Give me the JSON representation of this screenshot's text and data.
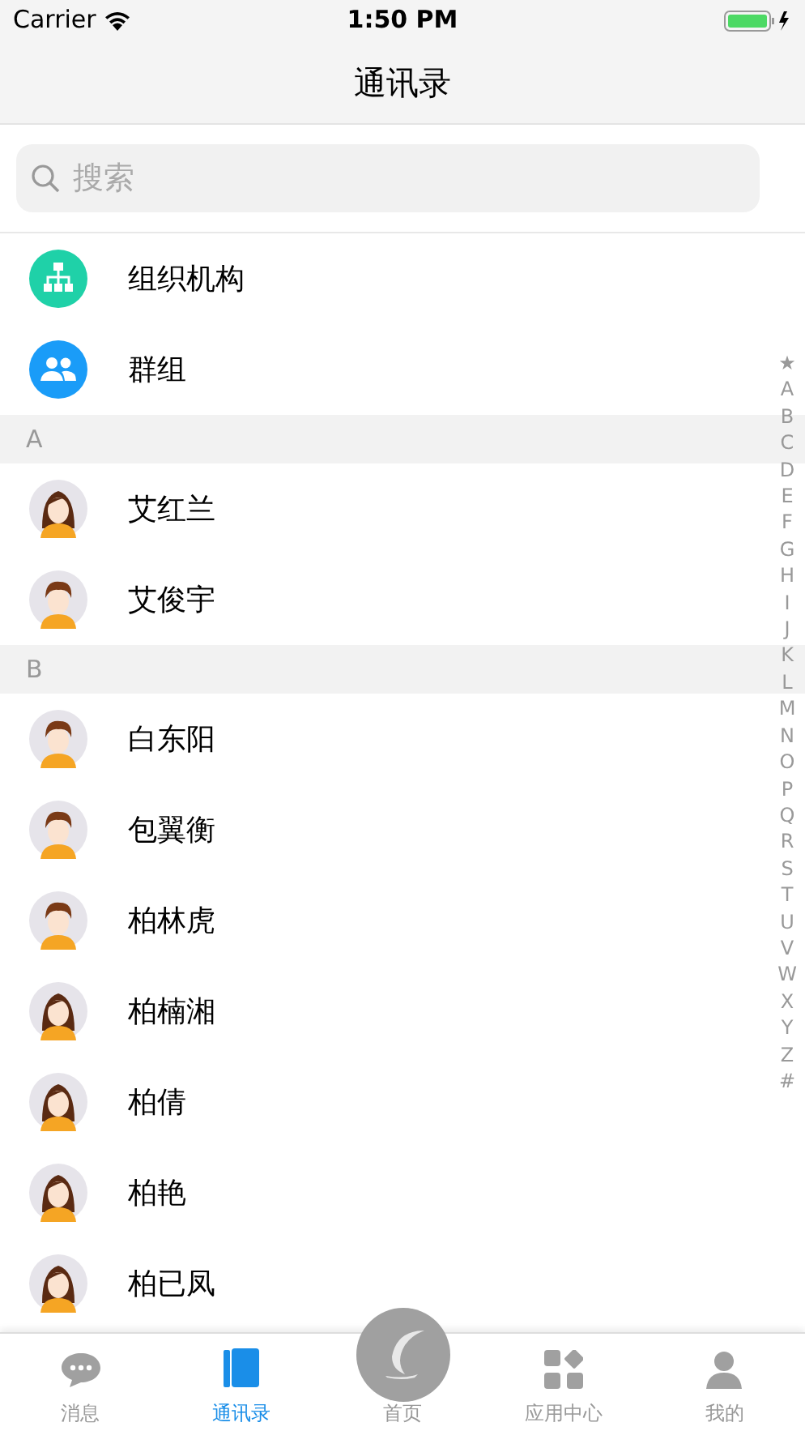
{
  "status_bar": {
    "carrier": "Carrier",
    "time": "1:50 PM"
  },
  "title": "通讯录",
  "search": {
    "placeholder": "搜索"
  },
  "shortcuts": [
    {
      "label": "组织机构",
      "kind": "org"
    },
    {
      "label": "群组",
      "kind": "group"
    }
  ],
  "sections": [
    {
      "letter": "A",
      "contacts": [
        {
          "name": "艾红兰",
          "kind": "female"
        },
        {
          "name": "艾俊宇",
          "kind": "male"
        }
      ]
    },
    {
      "letter": "B",
      "contacts": [
        {
          "name": "白东阳",
          "kind": "male"
        },
        {
          "name": "包翼衡",
          "kind": "male"
        },
        {
          "name": "柏林虎",
          "kind": "male"
        },
        {
          "name": "柏楠湘",
          "kind": "female"
        },
        {
          "name": "柏倩",
          "kind": "female"
        },
        {
          "name": "柏艳",
          "kind": "female"
        },
        {
          "name": "柏已凤",
          "kind": "female"
        }
      ]
    }
  ],
  "index": [
    "★",
    "A",
    "B",
    "C",
    "D",
    "E",
    "F",
    "G",
    "H",
    "I",
    "J",
    "K",
    "L",
    "M",
    "N",
    "O",
    "P",
    "Q",
    "R",
    "S",
    "T",
    "U",
    "V",
    "W",
    "X",
    "Y",
    "Z",
    "#"
  ],
  "tabs": [
    {
      "label": "消息",
      "kind": "chat",
      "selected": false
    },
    {
      "label": "通讯录",
      "kind": "contacts",
      "selected": true
    },
    {
      "label": "首页",
      "kind": "home",
      "selected": false
    },
    {
      "label": "应用中心",
      "kind": "apps",
      "selected": false
    },
    {
      "label": "我的",
      "kind": "me",
      "selected": false
    }
  ]
}
